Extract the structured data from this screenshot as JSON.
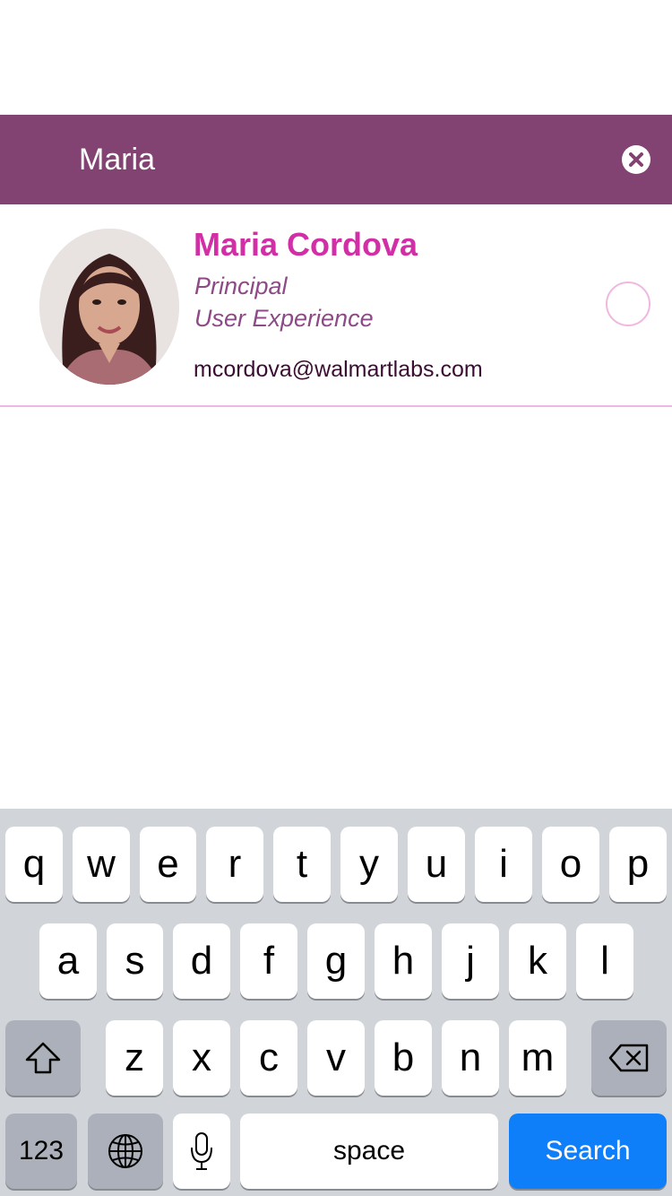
{
  "search": {
    "query": "Maria",
    "placeholder": ""
  },
  "result": {
    "name": "Maria Cordova",
    "title": "Principal",
    "department": "User Experience",
    "email": "mcordova@walmartlabs.com"
  },
  "keyboard": {
    "row1": [
      "q",
      "w",
      "e",
      "r",
      "t",
      "y",
      "u",
      "i",
      "o",
      "p"
    ],
    "row2": [
      "a",
      "s",
      "d",
      "f",
      "g",
      "h",
      "j",
      "k",
      "l"
    ],
    "row3": [
      "z",
      "x",
      "c",
      "v",
      "b",
      "n",
      "m"
    ],
    "numbers_label": "123",
    "space_label": "space",
    "search_label": "Search"
  },
  "colors": {
    "header": "#834372",
    "name": "#d22fa6",
    "accent": "#f0b8e0",
    "search_key": "#0f7ef9"
  }
}
